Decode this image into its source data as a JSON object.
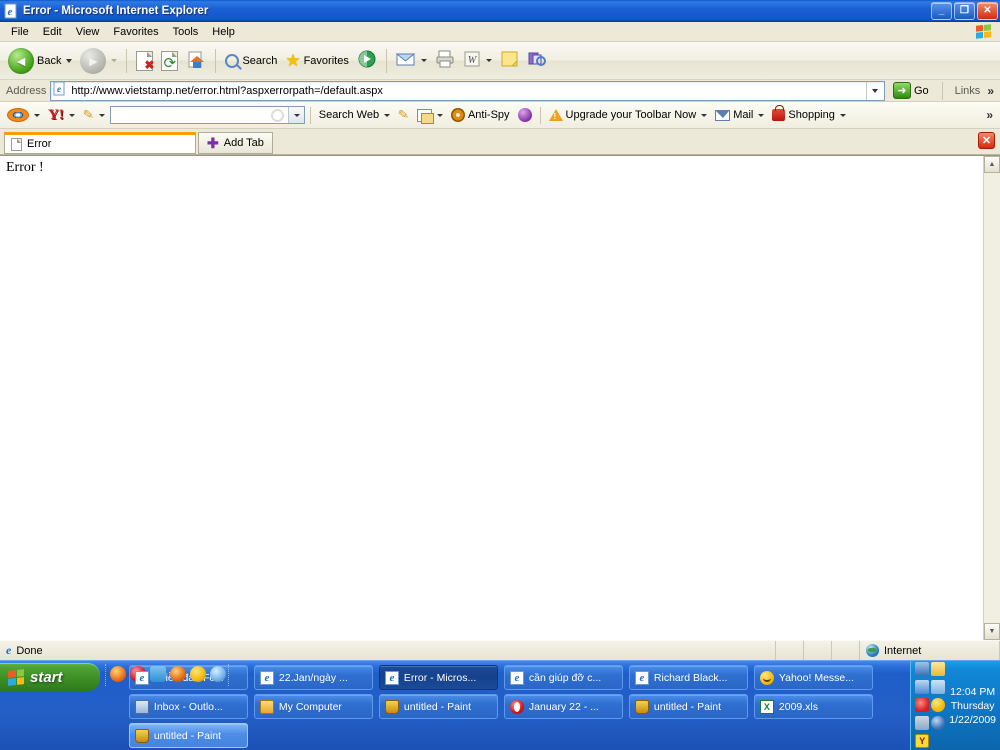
{
  "window": {
    "title": "Error - Microsoft Internet Explorer",
    "icon": "ie-document-icon",
    "minimize_label": "_",
    "restore_label": "❐",
    "close_label": "✕"
  },
  "menubar": {
    "items": [
      {
        "label": "File"
      },
      {
        "label": "Edit"
      },
      {
        "label": "View"
      },
      {
        "label": "Favorites"
      },
      {
        "label": "Tools"
      },
      {
        "label": "Help"
      }
    ]
  },
  "toolbar": {
    "back_label": "Back",
    "search_label": "Search",
    "favorites_label": "Favorites",
    "icons": [
      "back-icon",
      "forward-icon",
      "stop-icon",
      "refresh-icon",
      "home-icon",
      "search-icon",
      "favorites-star-icon",
      "media-icon",
      "mail-icon",
      "print-icon",
      "edit-word-icon",
      "note-icon",
      "discuss-icon"
    ]
  },
  "address": {
    "label": "Address",
    "url": "http://www.vietstamp.net/error.html?aspxerrorpath=/default.aspx",
    "go_label": "Go",
    "links_label": "Links",
    "overflow_label": "»"
  },
  "yahoo_toolbar": {
    "search_value": "",
    "search_web_label": "Search Web",
    "antispy_label": "Anti-Spy",
    "upgrade_label": "Upgrade your Toolbar Now",
    "mail_label": "Mail",
    "shopping_label": "Shopping",
    "overflow_label": "»"
  },
  "tabs": {
    "items": [
      {
        "label": "Error"
      }
    ],
    "add_tab_label": "Add Tab",
    "close_label": "✕"
  },
  "page": {
    "text": "Error !"
  },
  "statusbar": {
    "status": "Done",
    "zone": "Internet"
  },
  "taskbar": {
    "start_label": "start",
    "quicklaunch": [
      {
        "name": "firefox-icon",
        "color": "#e8701a"
      },
      {
        "name": "opera-icon",
        "color": "#cf1020"
      },
      {
        "name": "messenger-icon",
        "color": "#2f8fd8"
      },
      {
        "name": "media-player-icon",
        "color": "#e06a12"
      },
      {
        "name": "yahoo-messenger-icon",
        "color": "#f2b705"
      },
      {
        "name": "internet-explorer-icon",
        "color": "#6fb0e8"
      }
    ],
    "buttons": [
      {
        "label": "*Diễn đàn/Fo...",
        "icon": "ie",
        "state": "normal"
      },
      {
        "label": "22.Jan/ngày ...",
        "icon": "ie",
        "state": "normal"
      },
      {
        "label": "Error - Micros...",
        "icon": "ie",
        "state": "active"
      },
      {
        "label": "cần giúp đỡ c...",
        "icon": "ie",
        "state": "normal"
      },
      {
        "label": "Richard Black...",
        "icon": "ie",
        "state": "normal"
      },
      {
        "label": "Yahoo! Messe...",
        "icon": "ym",
        "state": "normal"
      },
      {
        "label": "Inbox - Outlo...",
        "icon": "outlook",
        "state": "normal"
      },
      {
        "label": "My Computer",
        "icon": "folder",
        "state": "normal"
      },
      {
        "label": "untitled - Paint",
        "icon": "paint",
        "state": "normal"
      },
      {
        "label": "January 22 - ...",
        "icon": "opera",
        "state": "normal"
      },
      {
        "label": "untitled - Paint",
        "icon": "paint",
        "state": "normal"
      },
      {
        "label": "2009.xls",
        "icon": "xls",
        "state": "normal"
      },
      {
        "label": "untitled - Paint",
        "icon": "paint",
        "state": "hover"
      }
    ],
    "tray": {
      "icons": [
        {
          "name": "network-icon",
          "color": "#3a6fb5"
        },
        {
          "name": "mail-notify-icon",
          "color": "#e8b83a"
        },
        {
          "name": "display-icon",
          "color": "#4a8ad0"
        },
        {
          "name": "users-icon",
          "color": "#7ab0e0"
        },
        {
          "name": "antivirus-icon",
          "color": "#d42020"
        },
        {
          "name": "messenger-smiley-icon",
          "color": "#f2b705"
        },
        {
          "name": "volume-icon",
          "color": "#8aa8c8"
        },
        {
          "name": "updates-icon",
          "color": "#3a6fb5"
        }
      ],
      "yahoo_icon": "yahoo-tray-icon",
      "time": "12:04 PM",
      "day": "Thursday",
      "date": "1/22/2009"
    }
  },
  "colors": {
    "titlebar_blue": "#1c5fd4",
    "taskbar_blue": "#245fc6",
    "start_green": "#3d8f26",
    "tab_active_orange": "#ff9c00",
    "close_red": "#d42b10"
  }
}
